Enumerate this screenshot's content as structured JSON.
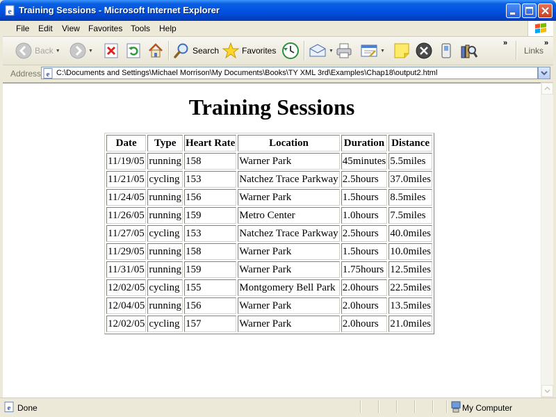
{
  "window": {
    "title": "Training Sessions - Microsoft Internet Explorer"
  },
  "menu": {
    "file": "File",
    "edit": "Edit",
    "view": "View",
    "favorites": "Favorites",
    "tools": "Tools",
    "help": "Help"
  },
  "toolbar": {
    "back": "Back",
    "search": "Search",
    "favorites": "Favorites",
    "links": "Links"
  },
  "address": {
    "label": "Address",
    "url": "C:\\Documents and Settings\\Michael Morrison\\My Documents\\Books\\TY XML 3rd\\Examples\\Chap18\\output2.html"
  },
  "page": {
    "heading": "Training Sessions",
    "table": {
      "headers": [
        "Date",
        "Type",
        "Heart Rate",
        "Location",
        "Duration",
        "Distance"
      ],
      "rows": [
        [
          "11/19/05",
          "running",
          "158",
          "Warner Park",
          "45minutes",
          "5.5miles"
        ],
        [
          "11/21/05",
          "cycling",
          "153",
          "Natchez Trace Parkway",
          "2.5hours",
          "37.0miles"
        ],
        [
          "11/24/05",
          "running",
          "156",
          "Warner Park",
          "1.5hours",
          "8.5miles"
        ],
        [
          "11/26/05",
          "running",
          "159",
          "Metro Center",
          "1.0hours",
          "7.5miles"
        ],
        [
          "11/27/05",
          "cycling",
          "153",
          "Natchez Trace Parkway",
          "2.5hours",
          "40.0miles"
        ],
        [
          "11/29/05",
          "running",
          "158",
          "Warner Park",
          "1.5hours",
          "10.0miles"
        ],
        [
          "11/31/05",
          "running",
          "159",
          "Warner Park",
          "1.75hours",
          "12.5miles"
        ],
        [
          "12/02/05",
          "cycling",
          "155",
          "Montgomery Bell Park",
          "2.0hours",
          "22.5miles"
        ],
        [
          "12/04/05",
          "running",
          "156",
          "Warner Park",
          "2.0hours",
          "13.5miles"
        ],
        [
          "12/02/05",
          "cycling",
          "157",
          "Warner Park",
          "2.0hours",
          "21.0miles"
        ]
      ]
    }
  },
  "status": {
    "text": "Done",
    "zone": "My Computer"
  }
}
